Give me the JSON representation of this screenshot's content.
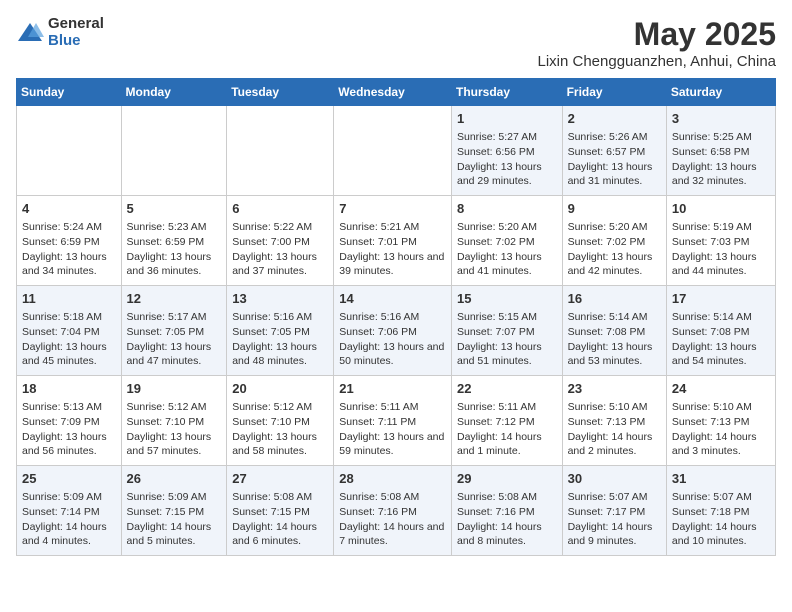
{
  "logo": {
    "general": "General",
    "blue": "Blue"
  },
  "title": "May 2025",
  "subtitle": "Lixin Chengguanzhen, Anhui, China",
  "days_of_week": [
    "Sunday",
    "Monday",
    "Tuesday",
    "Wednesday",
    "Thursday",
    "Friday",
    "Saturday"
  ],
  "weeks": [
    [
      {
        "day": "",
        "info": ""
      },
      {
        "day": "",
        "info": ""
      },
      {
        "day": "",
        "info": ""
      },
      {
        "day": "",
        "info": ""
      },
      {
        "day": "1",
        "info": "Sunrise: 5:27 AM\nSunset: 6:56 PM\nDaylight: 13 hours and 29 minutes."
      },
      {
        "day": "2",
        "info": "Sunrise: 5:26 AM\nSunset: 6:57 PM\nDaylight: 13 hours and 31 minutes."
      },
      {
        "day": "3",
        "info": "Sunrise: 5:25 AM\nSunset: 6:58 PM\nDaylight: 13 hours and 32 minutes."
      }
    ],
    [
      {
        "day": "4",
        "info": "Sunrise: 5:24 AM\nSunset: 6:59 PM\nDaylight: 13 hours and 34 minutes."
      },
      {
        "day": "5",
        "info": "Sunrise: 5:23 AM\nSunset: 6:59 PM\nDaylight: 13 hours and 36 minutes."
      },
      {
        "day": "6",
        "info": "Sunrise: 5:22 AM\nSunset: 7:00 PM\nDaylight: 13 hours and 37 minutes."
      },
      {
        "day": "7",
        "info": "Sunrise: 5:21 AM\nSunset: 7:01 PM\nDaylight: 13 hours and 39 minutes."
      },
      {
        "day": "8",
        "info": "Sunrise: 5:20 AM\nSunset: 7:02 PM\nDaylight: 13 hours and 41 minutes."
      },
      {
        "day": "9",
        "info": "Sunrise: 5:20 AM\nSunset: 7:02 PM\nDaylight: 13 hours and 42 minutes."
      },
      {
        "day": "10",
        "info": "Sunrise: 5:19 AM\nSunset: 7:03 PM\nDaylight: 13 hours and 44 minutes."
      }
    ],
    [
      {
        "day": "11",
        "info": "Sunrise: 5:18 AM\nSunset: 7:04 PM\nDaylight: 13 hours and 45 minutes."
      },
      {
        "day": "12",
        "info": "Sunrise: 5:17 AM\nSunset: 7:05 PM\nDaylight: 13 hours and 47 minutes."
      },
      {
        "day": "13",
        "info": "Sunrise: 5:16 AM\nSunset: 7:05 PM\nDaylight: 13 hours and 48 minutes."
      },
      {
        "day": "14",
        "info": "Sunrise: 5:16 AM\nSunset: 7:06 PM\nDaylight: 13 hours and 50 minutes."
      },
      {
        "day": "15",
        "info": "Sunrise: 5:15 AM\nSunset: 7:07 PM\nDaylight: 13 hours and 51 minutes."
      },
      {
        "day": "16",
        "info": "Sunrise: 5:14 AM\nSunset: 7:08 PM\nDaylight: 13 hours and 53 minutes."
      },
      {
        "day": "17",
        "info": "Sunrise: 5:14 AM\nSunset: 7:08 PM\nDaylight: 13 hours and 54 minutes."
      }
    ],
    [
      {
        "day": "18",
        "info": "Sunrise: 5:13 AM\nSunset: 7:09 PM\nDaylight: 13 hours and 56 minutes."
      },
      {
        "day": "19",
        "info": "Sunrise: 5:12 AM\nSunset: 7:10 PM\nDaylight: 13 hours and 57 minutes."
      },
      {
        "day": "20",
        "info": "Sunrise: 5:12 AM\nSunset: 7:10 PM\nDaylight: 13 hours and 58 minutes."
      },
      {
        "day": "21",
        "info": "Sunrise: 5:11 AM\nSunset: 7:11 PM\nDaylight: 13 hours and 59 minutes."
      },
      {
        "day": "22",
        "info": "Sunrise: 5:11 AM\nSunset: 7:12 PM\nDaylight: 14 hours and 1 minute."
      },
      {
        "day": "23",
        "info": "Sunrise: 5:10 AM\nSunset: 7:13 PM\nDaylight: 14 hours and 2 minutes."
      },
      {
        "day": "24",
        "info": "Sunrise: 5:10 AM\nSunset: 7:13 PM\nDaylight: 14 hours and 3 minutes."
      }
    ],
    [
      {
        "day": "25",
        "info": "Sunrise: 5:09 AM\nSunset: 7:14 PM\nDaylight: 14 hours and 4 minutes."
      },
      {
        "day": "26",
        "info": "Sunrise: 5:09 AM\nSunset: 7:15 PM\nDaylight: 14 hours and 5 minutes."
      },
      {
        "day": "27",
        "info": "Sunrise: 5:08 AM\nSunset: 7:15 PM\nDaylight: 14 hours and 6 minutes."
      },
      {
        "day": "28",
        "info": "Sunrise: 5:08 AM\nSunset: 7:16 PM\nDaylight: 14 hours and 7 minutes."
      },
      {
        "day": "29",
        "info": "Sunrise: 5:08 AM\nSunset: 7:16 PM\nDaylight: 14 hours and 8 minutes."
      },
      {
        "day": "30",
        "info": "Sunrise: 5:07 AM\nSunset: 7:17 PM\nDaylight: 14 hours and 9 minutes."
      },
      {
        "day": "31",
        "info": "Sunrise: 5:07 AM\nSunset: 7:18 PM\nDaylight: 14 hours and 10 minutes."
      }
    ]
  ]
}
